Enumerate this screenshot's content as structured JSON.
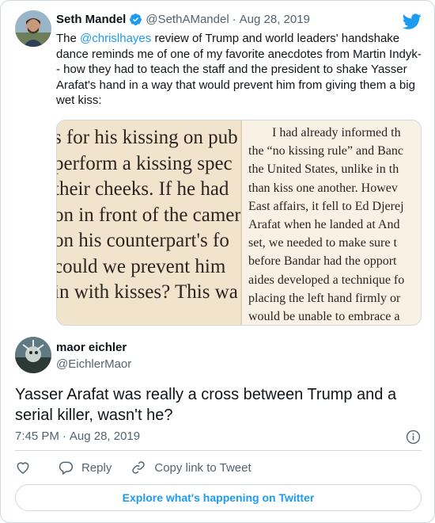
{
  "quoted_tweet": {
    "name": "Seth Mandel",
    "handle": "@SethAMandel",
    "date": "Aug 28, 2019",
    "dot": "·",
    "text_before": "The ",
    "mention": "@chrislhayes",
    "text_after": " review of Trump and world leaders' handshake dance reminds me of one of my favorite anecdotes from Martin Indyk- - how they had to teach the staff and the president to shake Yasser Arafat's hand in a way that would prevent him from giving them a big wet kiss:",
    "media_left_lines": [
      "s for his kissing on pub",
      "perform a kissing spec",
      "their cheeks. If he had",
      "on in front of the camer",
      "on his counterpart's fo",
      "could we prevent him",
      "in with kisses? This wa"
    ],
    "media_right_lines": [
      "I had already informed th",
      "the “no kissing rule” and Banc",
      "the United States, unlike in th",
      "than kiss one another. Howev",
      "East affairs, it fell to Ed Djerej",
      "Arafat when he landed at And",
      "set, we needed to make sure t",
      "before Bandar had the opport",
      "aides developed a technique fo",
      "placing the left hand firmly or",
      "would be unable to embrace a"
    ]
  },
  "reply": {
    "name": "maor eichler",
    "handle": "@EichlerMaor",
    "text": "Yasser Arafat was really a cross between Trump and a serial killer, wasn't he?",
    "time": "7:45 PM",
    "sep": "·",
    "date": "Aug 28, 2019"
  },
  "actions": {
    "reply_label": "Reply",
    "copy_label": "Copy link to Tweet"
  },
  "explore_label": "Explore what's happening on Twitter",
  "colors": {
    "accent": "#1d9bf0",
    "secondary_text": "#536471",
    "border": "#cfd9de"
  }
}
